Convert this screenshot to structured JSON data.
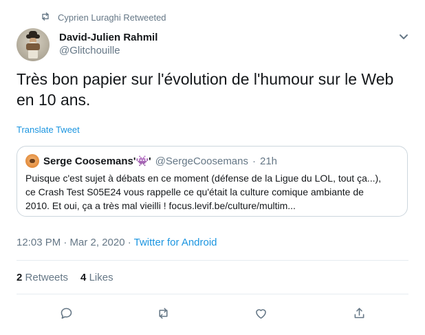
{
  "retweet_banner": {
    "text": "Cyprien Luraghi Retweeted"
  },
  "author": {
    "name": "David-Julien Rahmil",
    "handle": "@Glitchouille"
  },
  "tweet": {
    "text": "Très bon papier sur l'évolution de l'humour sur le Web en 10 ans.",
    "translate_label": "Translate Tweet"
  },
  "quote": {
    "name": "Serge Coosemans",
    "name_suffix": "'👾'",
    "handle": "@SergeCoosemans",
    "separator": "·",
    "time": "21h",
    "lines": [
      "Puisque c'est sujet à débats en ce moment (défense de la Ligue du LOL, tout ça...),",
      "ce Crash Test S05E24 vous rappelle ce qu'était la culture comique ambiante de",
      "2010. Et oui, ça a très mal vieilli ! focus.levif.be/culture/multim..."
    ]
  },
  "meta": {
    "time": "12:03 PM · Mar 2, 2020 · ",
    "source": "Twitter for Android"
  },
  "stats": {
    "retweets_count": "2",
    "retweets_label": "Retweets",
    "likes_count": "4",
    "likes_label": "Likes"
  },
  "colors": {
    "accent": "#1b95e0",
    "muted": "#657786",
    "border": "#e6ecf0"
  },
  "icons": [
    "retweet-icon",
    "caret-down-icon",
    "reply-icon",
    "retweet-icon",
    "like-icon",
    "share-icon"
  ]
}
